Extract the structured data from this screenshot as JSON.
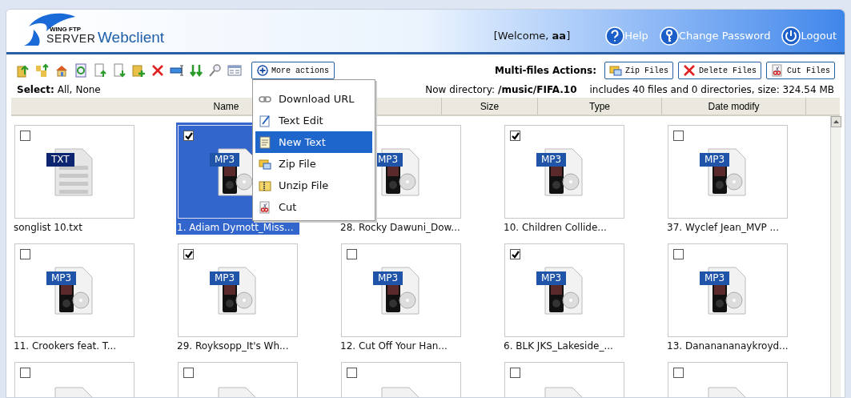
{
  "header": {
    "logo_top": "WING FTP",
    "logo_bottom": "SERVER",
    "title": "Webclient",
    "welcome": "[Welcome, **aa**]",
    "links": [
      {
        "kind": "help",
        "label": "Help"
      },
      {
        "kind": "key",
        "label": "Change Password"
      },
      {
        "kind": "power",
        "label": "Logout"
      }
    ]
  },
  "toolbar": {
    "more_actions": "More actions",
    "multi_label": "Multi-files Actions:",
    "multi_buttons": [
      {
        "kind": "zip",
        "label": "Zip Files"
      },
      {
        "kind": "delete",
        "label": "Delete Files"
      },
      {
        "kind": "cut",
        "label": "Cut Files"
      }
    ]
  },
  "select": {
    "label": "Select:",
    "all": "All",
    "separator": ",",
    "none": "None"
  },
  "directory": {
    "label": "Now directory:",
    "path": "/music/FIFA.10",
    "summary": "includes 40 files and 0 directories, size: 324.54 MB"
  },
  "columns": [
    "Name",
    "Size",
    "Type",
    "Date modify"
  ],
  "menu": [
    {
      "kind": "link",
      "label": "Download URL",
      "selected": false
    },
    {
      "kind": "edit",
      "label": "Text Edit",
      "selected": false
    },
    {
      "kind": "note",
      "label": "New Text",
      "selected": true
    },
    {
      "kind": "zip",
      "label": "Zip File",
      "selected": false
    },
    {
      "kind": "unzip",
      "label": "Unzip File",
      "selected": false
    },
    {
      "kind": "cut",
      "label": "Cut",
      "selected": false
    }
  ],
  "files": [
    {
      "kind": "txt",
      "badge": "TXT",
      "name": "songlist 10.txt",
      "checked": false,
      "selected": false
    },
    {
      "kind": "mp3",
      "badge": "MP3",
      "name": "1. Adiam Dymott_Miss...",
      "checked": true,
      "selected": true
    },
    {
      "kind": "mp3",
      "badge": "MP3",
      "name": "28. Rocky Dawuni_Dow...",
      "selected": false
    },
    {
      "kind": "mp3",
      "badge": "MP3",
      "name": "10. Children Collide...",
      "checked": true,
      "selected": false
    },
    {
      "kind": "mp3",
      "badge": "MP3",
      "name": "37. Wyclef Jean_MVP ...",
      "checked": false,
      "selected": false
    },
    {
      "kind": "mp3",
      "badge": "MP3",
      "name": "11. Crookers feat. T...",
      "checked": false,
      "selected": false
    },
    {
      "kind": "mp3",
      "badge": "MP3",
      "name": "29. Royksopp_It's Wh...",
      "checked": true,
      "selected": false
    },
    {
      "kind": "mp3",
      "badge": "MP3",
      "name": "12. Cut Off Your Han...",
      "checked": false,
      "selected": false
    },
    {
      "kind": "mp3",
      "badge": "MP3",
      "name": "6. BLK JKS_Lakeside_...",
      "checked": true,
      "selected": false
    },
    {
      "kind": "mp3",
      "badge": "MP3",
      "name": "13. Dananananaykroyd...",
      "checked": false,
      "selected": false
    },
    {
      "kind": "mp3",
      "checked": false,
      "selected": false
    },
    {
      "kind": "mp3",
      "checked": false,
      "selected": false
    },
    {
      "kind": "mp3",
      "checked": false,
      "selected": false
    },
    {
      "kind": "mp3",
      "checked": false,
      "selected": false
    },
    {
      "kind": "mp3",
      "checked": false,
      "selected": false
    }
  ]
}
